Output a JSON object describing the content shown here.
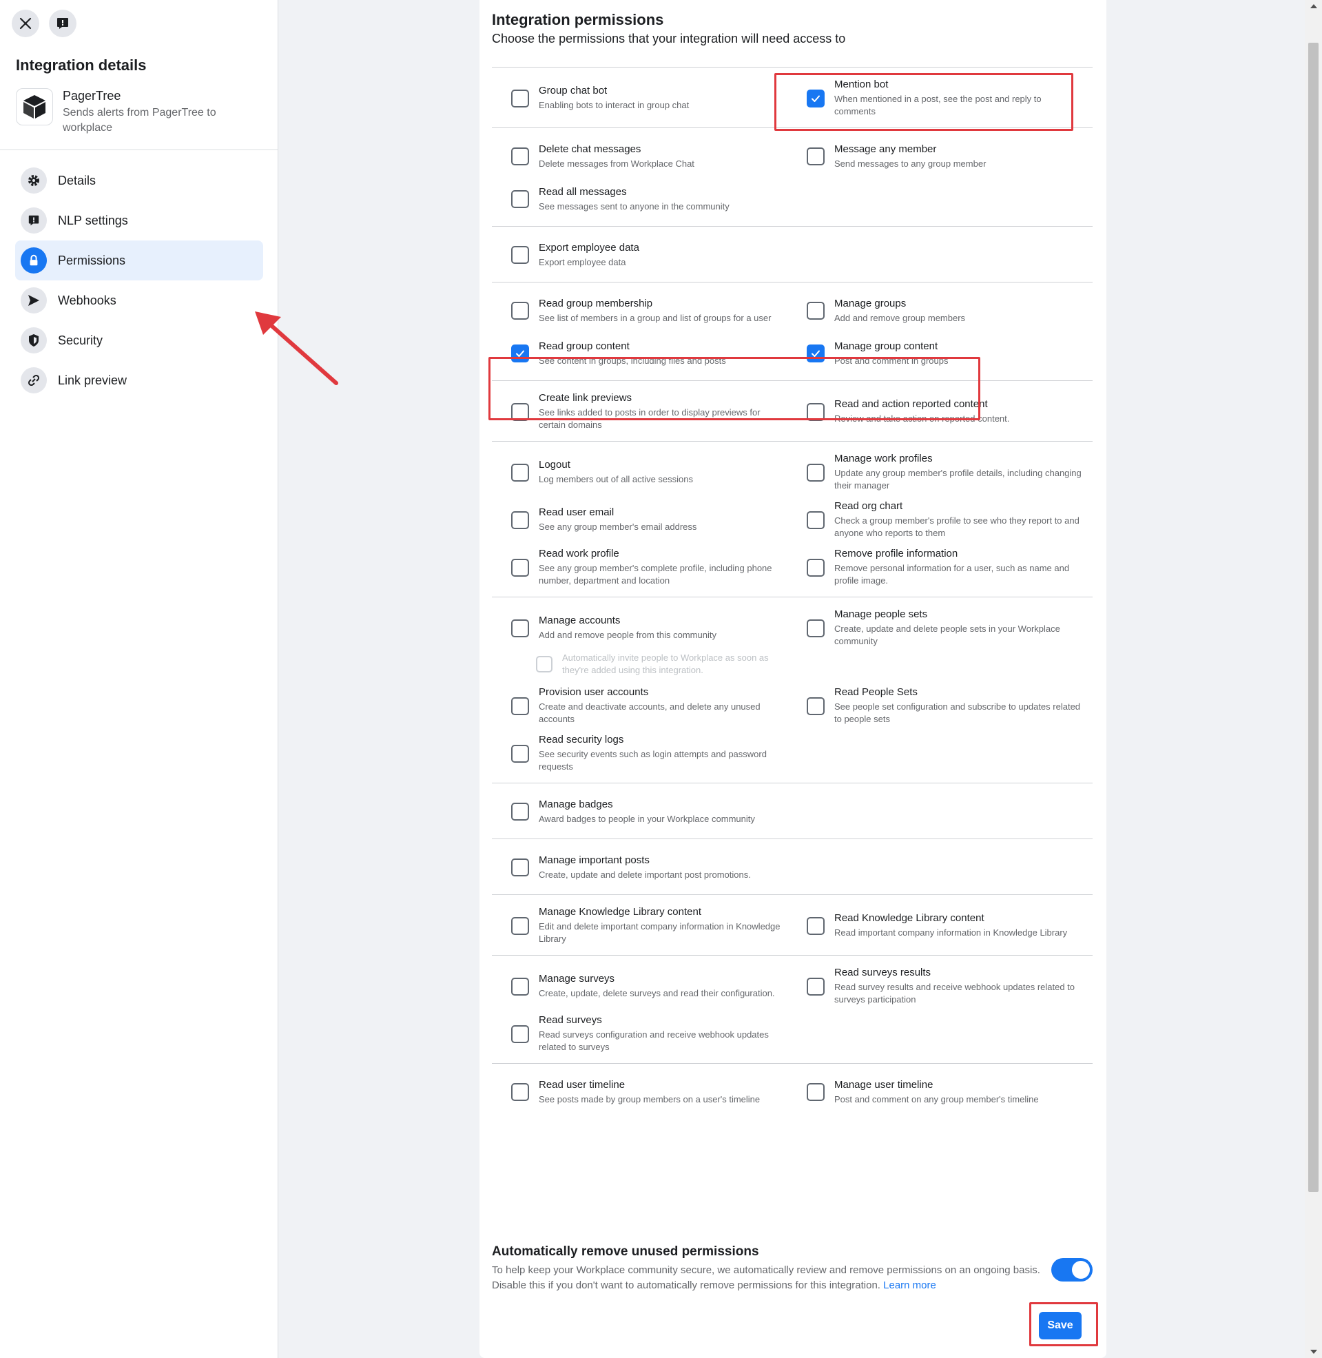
{
  "sidebar": {
    "title": "Integration details",
    "app": {
      "name": "PagerTree",
      "description": "Sends alerts from PagerTree to workplace"
    },
    "nav": [
      {
        "label": "Details",
        "icon": "gear-icon"
      },
      {
        "label": "NLP settings",
        "icon": "alert-icon"
      },
      {
        "label": "Permissions",
        "icon": "lock-icon",
        "active": true
      },
      {
        "label": "Webhooks",
        "icon": "send-icon"
      },
      {
        "label": "Security",
        "icon": "shield-icon"
      },
      {
        "label": "Link preview",
        "icon": "link-icon"
      }
    ]
  },
  "main": {
    "title": "Integration permissions",
    "subtitle": "Choose the permissions that your integration will need access to",
    "groups": [
      {
        "items": [
          {
            "title": "Group chat bot",
            "desc": "Enabling bots to interact in group chat",
            "checked": false
          },
          {
            "title": "Mention bot",
            "desc": "When mentioned in a post, see the post and reply to comments",
            "checked": true
          }
        ]
      },
      {
        "items": [
          {
            "title": "Delete chat messages",
            "desc": "Delete messages from Workplace Chat",
            "checked": false
          },
          {
            "title": "Message any member",
            "desc": "Send messages to any group member",
            "checked": false
          },
          {
            "title": "Read all messages",
            "desc": "See messages sent to anyone in the community",
            "checked": false
          }
        ]
      },
      {
        "items": [
          {
            "title": "Export employee data",
            "desc": "Export employee data",
            "checked": false
          }
        ]
      },
      {
        "items": [
          {
            "title": "Read group membership",
            "desc": "See list of members in a group and list of groups for a user",
            "checked": false
          },
          {
            "title": "Manage groups",
            "desc": "Add and remove group members",
            "checked": false
          },
          {
            "title": "Read group content",
            "desc": "See content in groups, including files and posts",
            "checked": true
          },
          {
            "title": "Manage group content",
            "desc": "Post and comment in groups",
            "checked": true
          }
        ]
      },
      {
        "items": [
          {
            "title": "Create link previews",
            "desc": "See links added to posts in order to display previews for certain domains",
            "checked": false
          },
          {
            "title": "Read and action reported content",
            "desc": "Review and take action on reported content.",
            "checked": false
          }
        ]
      },
      {
        "items": [
          {
            "title": "Logout",
            "desc": "Log members out of all active sessions",
            "checked": false
          },
          {
            "title": "Manage work profiles",
            "desc": "Update any group member's profile details, including changing their manager",
            "checked": false
          },
          {
            "title": "Read user email",
            "desc": "See any group member's email address",
            "checked": false
          },
          {
            "title": "Read org chart",
            "desc": "Check a group member's profile to see who they report to and anyone who reports to them",
            "checked": false
          },
          {
            "title": "Read work profile",
            "desc": "See any group member's complete profile, including phone number, department and location",
            "checked": false
          },
          {
            "title": "Remove profile information",
            "desc": "Remove personal information for a user, such as name and profile image.",
            "checked": false
          }
        ]
      },
      {
        "items": [
          {
            "title": "Manage accounts",
            "desc": "Add and remove people from this community",
            "checked": false
          },
          {
            "title": "Manage people sets",
            "desc": "Create, update and delete people sets in your Workplace community",
            "checked": false
          },
          {
            "sub": "Automatically invite people to Workplace as soon as they're added using this integration."
          },
          {
            "title": "Provision user accounts",
            "desc": "Create and deactivate accounts, and delete any unused accounts",
            "checked": false
          },
          {
            "title": "Read People Sets",
            "desc": "See people set configuration and subscribe to updates related to people sets",
            "checked": false
          },
          {
            "title": "Read security logs",
            "desc": "See security events such as login attempts and password requests",
            "checked": false
          }
        ]
      },
      {
        "items": [
          {
            "title": "Manage badges",
            "desc": "Award badges to people in your Workplace community",
            "checked": false
          }
        ]
      },
      {
        "items": [
          {
            "title": "Manage important posts",
            "desc": "Create, update and delete important post promotions.",
            "checked": false
          }
        ]
      },
      {
        "items": [
          {
            "title": "Manage Knowledge Library content",
            "desc": "Edit and delete important company information in Knowledge Library",
            "checked": false
          },
          {
            "title": "Read Knowledge Library content",
            "desc": "Read important company information in Knowledge Library",
            "checked": false
          }
        ]
      },
      {
        "items": [
          {
            "title": "Manage surveys",
            "desc": "Create, update, delete surveys and read their configuration.",
            "checked": false
          },
          {
            "title": "Read surveys results",
            "desc": "Read survey results and receive webhook updates related to surveys participation",
            "checked": false
          },
          {
            "title": "Read surveys",
            "desc": "Read surveys configuration and receive webhook updates related to surveys",
            "checked": false
          }
        ]
      },
      {
        "items": [
          {
            "title": "Read user timeline",
            "desc": "See posts made by group members on a user's timeline",
            "checked": false
          },
          {
            "title": "Manage user timeline",
            "desc": "Post and comment on any group member's timeline",
            "checked": false
          }
        ]
      }
    ],
    "auto_remove": {
      "title": "Automatically remove unused permissions",
      "desc": "To help keep your Workplace community secure, we automatically review and remove permissions on an ongoing basis. Disable this if you don't want to automatically remove permissions for this integration.",
      "link": "Learn more",
      "enabled": true
    },
    "save_label": "Save"
  },
  "colors": {
    "accent": "#1877f2",
    "highlight": "#e0393e"
  }
}
